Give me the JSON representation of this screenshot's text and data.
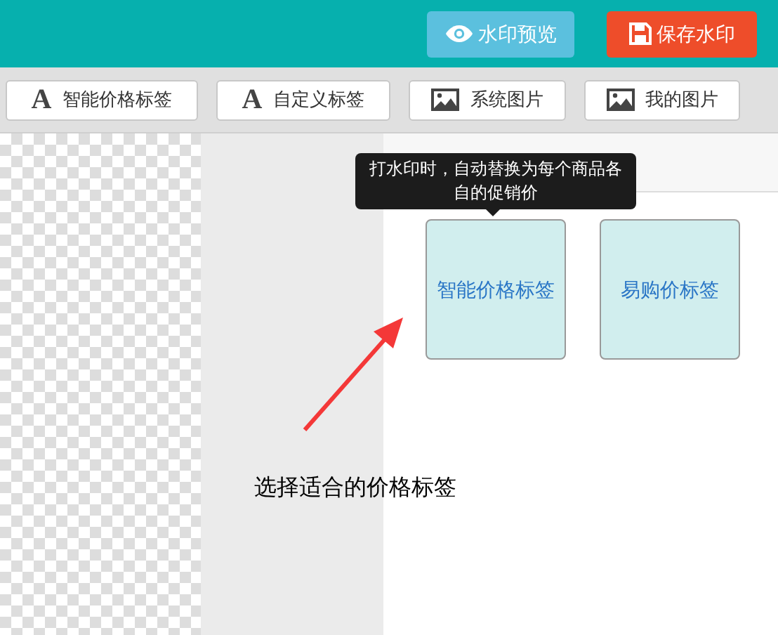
{
  "header": {
    "buttons": [
      {
        "kind": "preview",
        "label": "水印预览"
      },
      {
        "kind": "save",
        "label": "保存水印"
      }
    ]
  },
  "toolbar": [
    {
      "kind": "text",
      "icon": "A",
      "label": "智能价格标签"
    },
    {
      "kind": "text",
      "icon": "A",
      "label": "自定义标签"
    },
    {
      "kind": "image",
      "label": "系统图片"
    },
    {
      "kind": "image",
      "label": "我的图片"
    }
  ],
  "tooltip": "打水印时，自动替换为每个商品各自的促销价",
  "cards": [
    {
      "label": "智能价格标签"
    },
    {
      "label": "易购价标签"
    }
  ],
  "annotation": "选择适合的价格标签"
}
